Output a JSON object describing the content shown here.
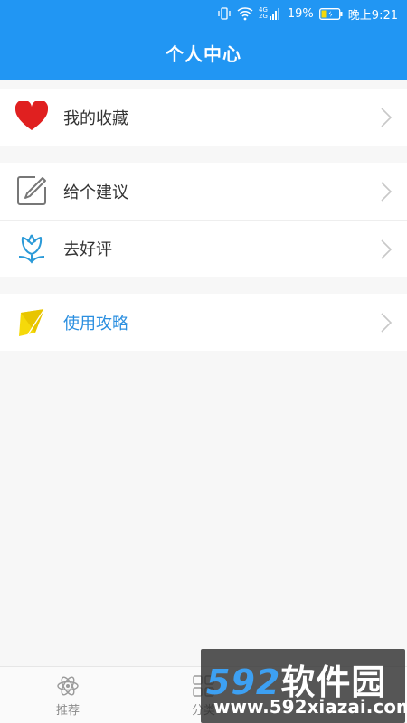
{
  "status_bar": {
    "battery_percent": "19%",
    "time": "晚上9:21",
    "network_label_top": "4G",
    "network_label_bottom": "2G",
    "icons": [
      "vibrate-icon",
      "wifi-icon",
      "signal-icon",
      "battery-icon"
    ]
  },
  "header": {
    "title": "个人中心"
  },
  "groups": [
    {
      "items": [
        {
          "label": "我的收藏",
          "icon": "heart-icon"
        }
      ]
    },
    {
      "items": [
        {
          "label": "给个建议",
          "icon": "edit-icon"
        },
        {
          "label": "去好评",
          "icon": "tulip-icon"
        }
      ]
    },
    {
      "items": [
        {
          "label": "使用攻略",
          "icon": "kite-icon"
        }
      ]
    }
  ],
  "tabbar": {
    "tabs": [
      {
        "label": "推荐",
        "icon": "atom-icon"
      },
      {
        "label": "分类",
        "icon": "grid-icon"
      }
    ]
  },
  "watermark": {
    "brand": "592",
    "brand_cn": "软件园",
    "url": "www.592xiazai.com"
  },
  "colors": {
    "header": "#2196f3",
    "heart": "#e02020",
    "accent_blue": "#2b8fe0",
    "kite": "#f5d90a"
  }
}
